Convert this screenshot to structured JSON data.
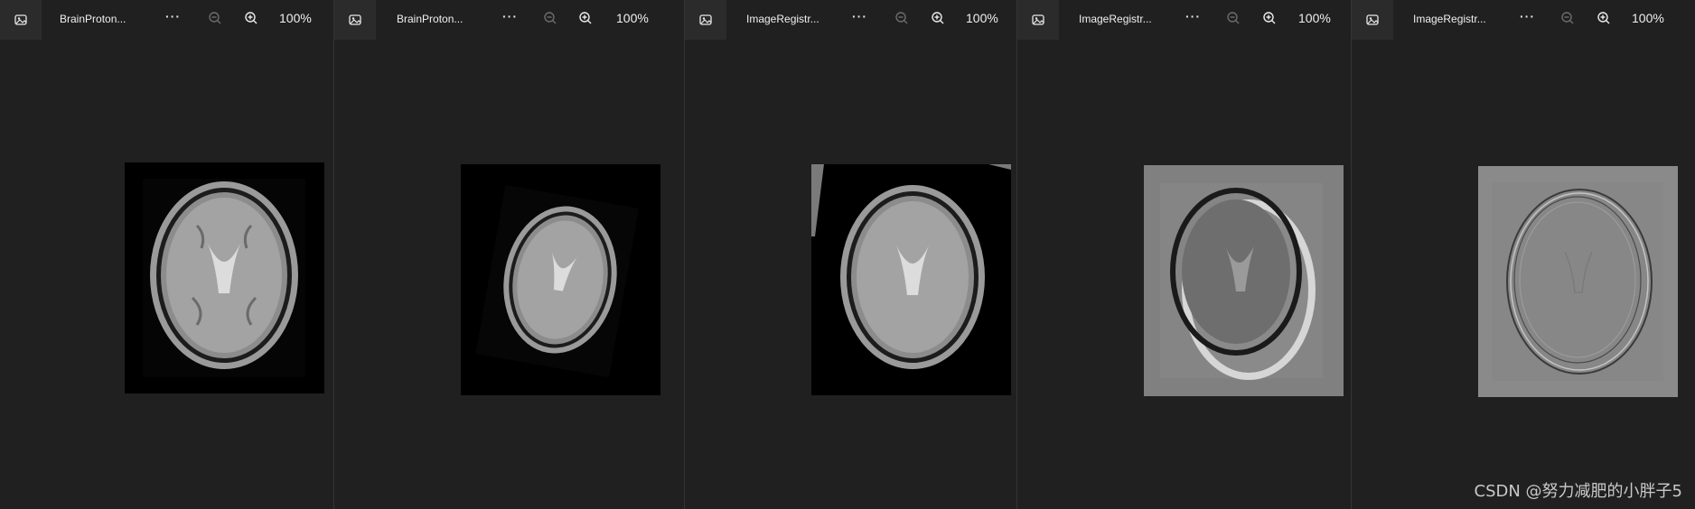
{
  "viewers": [
    {
      "title": "BrainProton...",
      "zoom_level": "100%"
    },
    {
      "title": "BrainProton...",
      "zoom_level": "100%"
    },
    {
      "title": "ImageRegistr...",
      "zoom_level": "100%"
    },
    {
      "title": "ImageRegistr...",
      "zoom_level": "100%"
    },
    {
      "title": "ImageRegistr...",
      "zoom_level": "100%"
    }
  ],
  "watermark": "CSDN @努力减肥的小胖子5",
  "colors": {
    "background": "#202020",
    "toolbar_button": "#2b2b2b",
    "divider": "#343434"
  }
}
